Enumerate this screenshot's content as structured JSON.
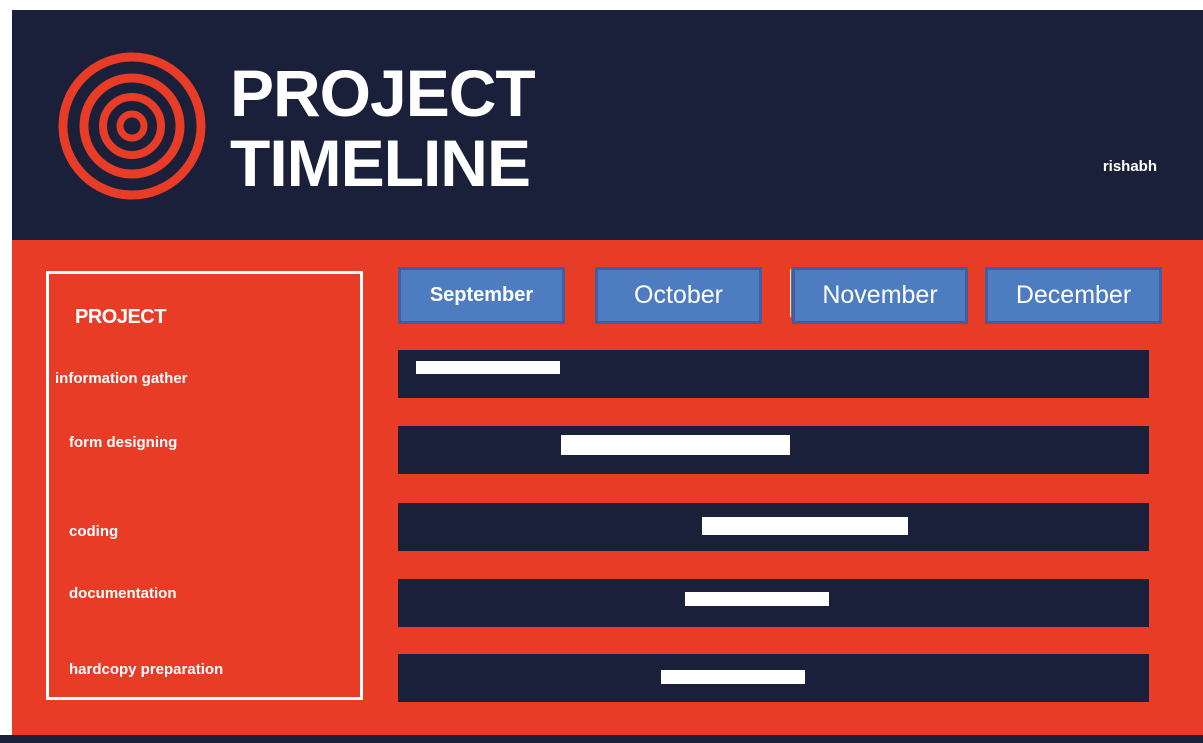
{
  "header": {
    "title_line1": "PROJECT",
    "title_line2": "TIMELINE",
    "author": "rishabh"
  },
  "colors": {
    "navy": "#1a2039",
    "red": "#e83c26",
    "month_blue": "#4e7cc0",
    "white": "#ffffff"
  },
  "icons": {
    "logo": "concentric-circles-icon"
  },
  "panel": {
    "heading": "PROJECT",
    "tasks": [
      {
        "label": "information gather"
      },
      {
        "label": "form designing"
      },
      {
        "label": "coding"
      },
      {
        "label": "documentation"
      },
      {
        "label": "hardcopy preparation"
      }
    ]
  },
  "months": [
    {
      "label": "September"
    },
    {
      "label": "October"
    },
    {
      "label": "November"
    },
    {
      "label": "December"
    }
  ]
}
